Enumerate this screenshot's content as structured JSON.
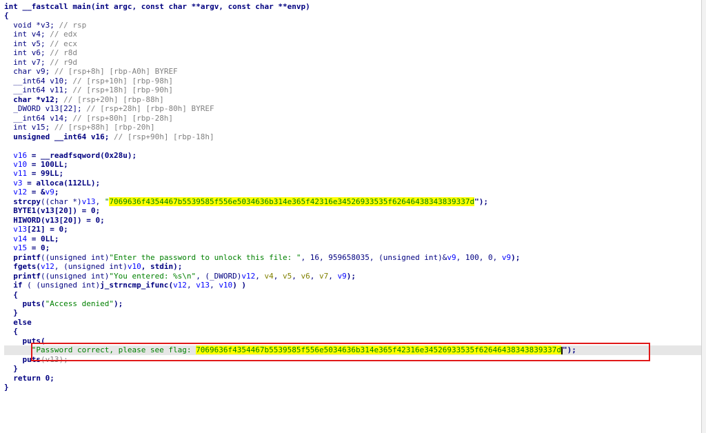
{
  "header": {
    "kw_int": "int",
    "fastcall": " __fastcall",
    "fn": " main(",
    "p1t": "int",
    "p1": " argc, ",
    "p2t": "const char",
    "p2": " **argv, ",
    "p3t": "const char",
    "p3": " **envp)"
  },
  "brace_open": "{",
  "brace_close": "}",
  "decls": [
    {
      "type": "void",
      "name": " *v3; ",
      "comment": "// rsp",
      "bold": false
    },
    {
      "type": "int",
      "name": " v4; ",
      "comment": "// edx",
      "bold": false
    },
    {
      "type": "int",
      "name": " v5; ",
      "comment": "// ecx",
      "bold": false
    },
    {
      "type": "int",
      "name": " v6; ",
      "comment": "// r8d",
      "bold": false
    },
    {
      "type": "int",
      "name": " v7; ",
      "comment": "// r9d",
      "bold": false
    },
    {
      "type": "char",
      "name": " v9; ",
      "comment": "// [rsp+8h] [rbp-A0h] BYREF",
      "bold": false
    },
    {
      "type": "__int64",
      "name": " v10; ",
      "comment": "// [rsp+10h] [rbp-98h]",
      "bold": false
    },
    {
      "type": "__int64",
      "name": " v11; ",
      "comment": "// [rsp+18h] [rbp-90h]",
      "bold": false
    },
    {
      "type": "char",
      "name": " *v12; ",
      "comment": "// [rsp+20h] [rbp-88h]",
      "bold": true
    },
    {
      "type": "_DWORD",
      "name": " v13[22]; ",
      "comment": "// [rsp+28h] [rbp-80h] BYREF",
      "bold": false
    },
    {
      "type": "__int64",
      "name": " v14; ",
      "comment": "// [rsp+80h] [rbp-28h]",
      "bold": false
    },
    {
      "type": "int",
      "name": " v15; ",
      "comment": "// [rsp+88h] [rbp-20h]",
      "bold": false
    },
    {
      "type": "unsigned __int64",
      "name": " v16; ",
      "comment": "// [rsp+90h] [rbp-18h]",
      "bold": true
    }
  ],
  "stmts": {
    "s1_var": "v16",
    "s1_rest": " = __readfsqword(0x28u);",
    "s2_var": "v10",
    "s2_rest": " = 100LL;",
    "s3_var": "v11",
    "s3_rest": " = 99LL;",
    "s4_var": "v3",
    "s4_rest": " = alloca(112LL);",
    "s5_var": "v12",
    "s5_rest": " = &",
    "s5_v9": "v9",
    "s5_end": ";",
    "strcpy_fn": "strcpy",
    "strcpy_cast": "((char *)",
    "strcpy_v13": "v13",
    "strcpy_sep": ", ",
    "flag_hex": "7069636f4354467b5539585f556e5034636b314e365f42316e34526933535f62646438343839337d",
    "strcpy_end": "\");",
    "byte1": "BYTE1",
    "byte1_arg": "(v13[20]) = 0;",
    "hiword": "HIWORD",
    "hiword_arg": "(v13[20]) = 0;",
    "v13_21": "v13",
    "v13_21_rest": "[21] = 0;",
    "v14": "v14",
    "v14_rest": " = 0LL;",
    "v15": "v15",
    "v15_rest": " = 0;",
    "printf": "printf",
    "p1_cast": "((unsigned int)",
    "p1_str": "\"Enter the password to unlock this file: \"",
    "p1_args": ", 16, 959658035, (unsigned int)&",
    "p1_v9": "v9",
    "p1_args2": ", 100, 0, ",
    "p1_v9b": "v9",
    "p1_end": ");",
    "fgets": "fgets",
    "fgets_open": "(",
    "fgets_v12": "v12",
    "fgets_mid": ", (unsigned int)",
    "fgets_v10": "v10",
    "fgets_rest": ", stdin);",
    "p2_cast": "((unsigned int)",
    "p2_str": "\"You entered: %s\\n\"",
    "p2_mid": ", (_DWORD)",
    "p2_v12": "v12",
    "p2_c": ", ",
    "p2_v4": "v4",
    "p2_v5": "v5",
    "p2_v6": "v6",
    "p2_v7": "v7",
    "p2_v9": "v9",
    "p2_end": ");",
    "if_kw": "if",
    "if_open": " ( (unsigned int)",
    "if_fn": "j_strncmp_ifunc",
    "if_args_open": "(",
    "if_v12": "v12",
    "if_v13": "v13",
    "if_v10": "v10",
    "if_end": ") )",
    "puts": "puts",
    "denied": "\"Access denied\"",
    "puts_end": ");",
    "else_kw": "else",
    "puts_open": "(",
    "correct": "\"Password correct, please see flag: ",
    "flag_hex2": "7069636f4354467b5539585f556e5034636b314e365f42316e34526933535f62646438343839337",
    "flag_last": "d",
    "correct_end": "\");",
    "puts2_arg": "(v13);",
    "return_kw": "return",
    "return_rest": " 0;"
  }
}
